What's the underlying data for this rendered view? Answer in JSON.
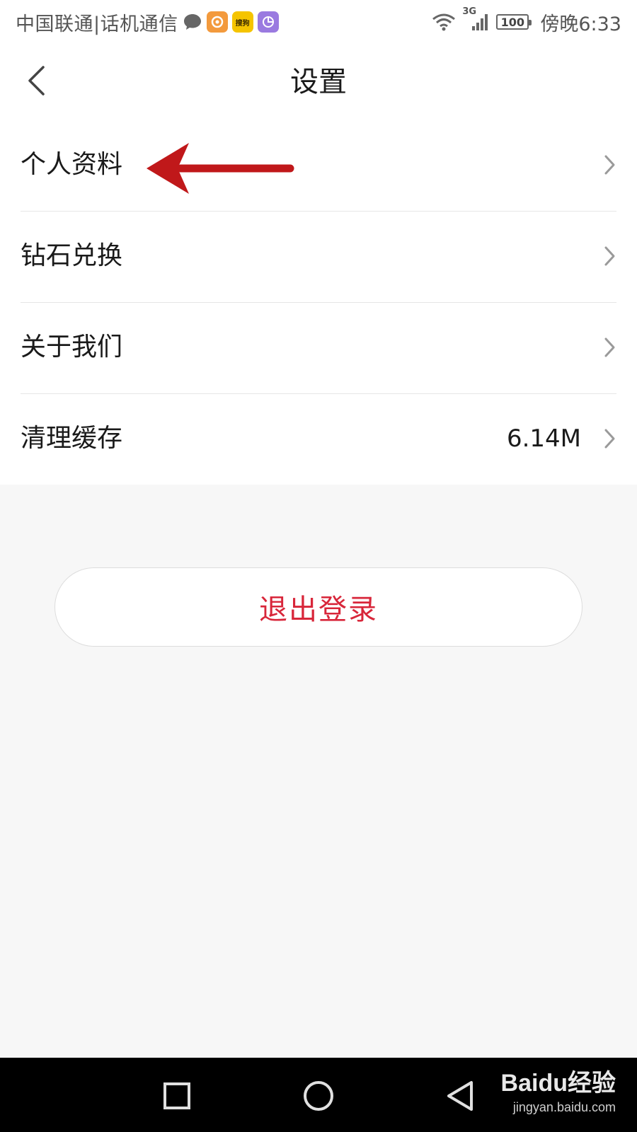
{
  "status_bar": {
    "carrier": "中国联通|话机通信",
    "battery": "100",
    "time": "傍晚6:33",
    "network": "3G",
    "icons": [
      "message-icon",
      "uc-browser-icon",
      "app-yellow-icon",
      "app-purple-icon",
      "wifi-icon",
      "signal-icon",
      "battery-icon"
    ],
    "app_badge_label": "搜狗"
  },
  "header": {
    "title": "设置",
    "back_icon": "chevron-left-icon"
  },
  "settings": {
    "items": [
      {
        "label": "个人资料",
        "value": ""
      },
      {
        "label": "钻石兑换",
        "value": ""
      },
      {
        "label": "关于我们",
        "value": ""
      },
      {
        "label": "清理缓存",
        "value": "6.14M"
      }
    ]
  },
  "logout": {
    "label": "退出登录",
    "color": "#d8263a"
  },
  "nav_bar": {
    "icons": [
      "recent-apps-icon",
      "home-icon",
      "back-triangle-icon"
    ]
  },
  "watermark": {
    "logo": "Baidu经验",
    "url": "jingyan.baidu.com"
  },
  "colors": {
    "annotation_arrow": "#c0181a",
    "accent": "#d8263a"
  }
}
